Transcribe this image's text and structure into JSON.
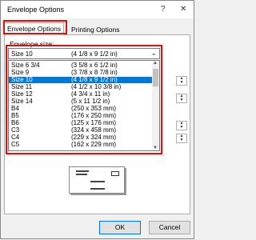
{
  "window": {
    "title": "Envelope Options",
    "help_glyph": "?",
    "close_glyph": "✕"
  },
  "tabs": [
    {
      "label": "Envelope Options",
      "active": true
    },
    {
      "label": "Printing Options",
      "active": false
    }
  ],
  "envelope_size": {
    "label": "Envelope size:",
    "selected": {
      "name": "Size 10",
      "dims": "(4 1/8 x 9 1/2 in)"
    },
    "options": [
      {
        "name": "Size 6 3/4",
        "dims": "(3 5/8 x 6 1/2 in)"
      },
      {
        "name": "Size 9",
        "dims": "(3 7/8 x 8 7/8 in)"
      },
      {
        "name": "Size 10",
        "dims": "(4 1/8 x 9 1/2 in)",
        "selected": true
      },
      {
        "name": "Size 11",
        "dims": "(4 1/2 x 10 3/8 in)"
      },
      {
        "name": "Size 12",
        "dims": "(4 3/4 x 11 in)"
      },
      {
        "name": "Size 14",
        "dims": "(5 x 11 1/2 in)"
      },
      {
        "name": "B4",
        "dims": "(250 x 353 mm)"
      },
      {
        "name": "B5",
        "dims": "(176 x 250 mm)"
      },
      {
        "name": "B6",
        "dims": "(125 x 176 mm)"
      },
      {
        "name": "C3",
        "dims": "(324 x 458 mm)"
      },
      {
        "name": "C4",
        "dims": "(229 x 324 mm)"
      },
      {
        "name": "C5",
        "dims": "(162 x 229 mm)"
      }
    ]
  },
  "buttons": {
    "ok": "OK",
    "cancel": "Cancel"
  },
  "icons": {
    "dropdown": "chevron-down-icon",
    "scroll_up": "arrow-up-icon",
    "scroll_down": "arrow-down-icon"
  },
  "colors": {
    "selection": "#0078d7",
    "highlight_border": "#e01010"
  }
}
